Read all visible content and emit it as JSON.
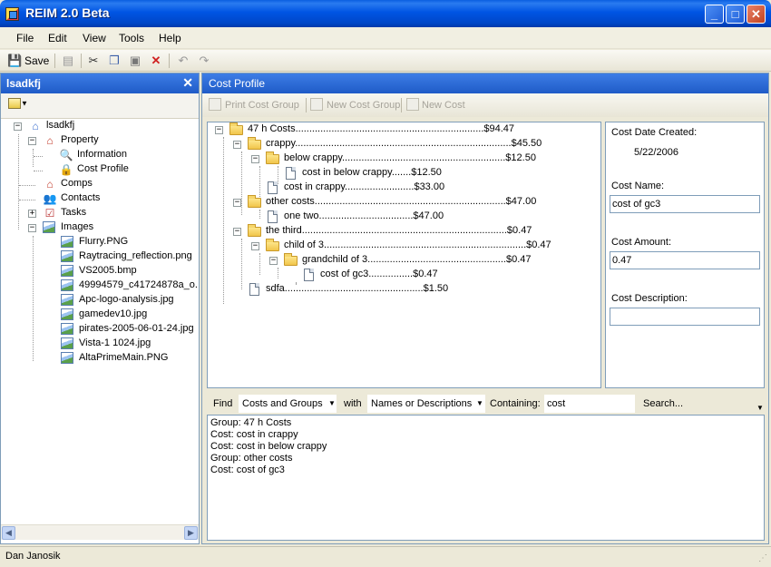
{
  "window": {
    "title": "REIM 2.0 Beta"
  },
  "menu": [
    "File",
    "Edit",
    "View",
    "Tools",
    "Help"
  ],
  "toolbar": {
    "save_label": "Save"
  },
  "left_panel": {
    "title": "lsadkfj",
    "tree": {
      "root": "lsadkfj",
      "property": "Property",
      "information": "Information",
      "cost_profile": "Cost Profile",
      "comps": "Comps",
      "contacts": "Contacts",
      "tasks": "Tasks",
      "images": "Images",
      "image_files": [
        "Flurry.PNG",
        "Raytracing_reflection.png",
        "VS2005.bmp",
        "49994579_c41724878a_o.",
        "Apc-logo-analysis.jpg",
        "gamedev10.jpg",
        "pirates-2005-06-01-24.jpg",
        "Vista-1 1024.jpg",
        "AltaPrimeMain.PNG"
      ]
    }
  },
  "cost_profile": {
    "title": "Cost Profile",
    "toolbar": {
      "print": "Print Cost Group",
      "new_group": "New Cost Group",
      "new_cost": "New Cost"
    },
    "tree": [
      {
        "text": "47 h Costs....................................................................$94.47"
      },
      {
        "text": "crappy..............................................................................$45.50"
      },
      {
        "text": "below crappy...........................................................$12.50"
      },
      {
        "text": "cost in below crappy.......$12.50"
      },
      {
        "text": "cost in crappy.........................$33.00"
      },
      {
        "text": "other costs.....................................................................$47.00"
      },
      {
        "text": "one two..................................$47.00"
      },
      {
        "text": "the third..........................................................................$0.47"
      },
      {
        "text": "child of 3.........................................................................$0.47"
      },
      {
        "text": "grandchild of 3..................................................$0.47"
      },
      {
        "text": "cost of gc3................$0.47"
      },
      {
        "text": "sdfa..................................................$1.50"
      }
    ],
    "details": {
      "date_label": "Cost Date Created:",
      "date_value": "5/22/2006",
      "name_label": "Cost Name:",
      "name_value": "cost of gc3",
      "amount_label": "Cost Amount:",
      "amount_value": "0.47",
      "description_label": "Cost Description:",
      "description_value": ""
    },
    "search": {
      "find_label": "Find",
      "find_value": "Costs and Groups",
      "with_label": "with",
      "with_value": "Names or Descriptions",
      "containing_label": "Containing:",
      "query": "cost",
      "search_button": "Search..."
    },
    "results": [
      "Group: 47 h Costs",
      "Cost: cost in crappy",
      "Cost: cost in below crappy",
      "Group: other costs",
      "Cost: cost of gc3"
    ]
  },
  "status": {
    "user": "Dan Janosik"
  },
  "colors": {
    "title_bar": "#0054e3",
    "panel_header": "#2a66d4",
    "window_bg": "#ece9d8"
  }
}
